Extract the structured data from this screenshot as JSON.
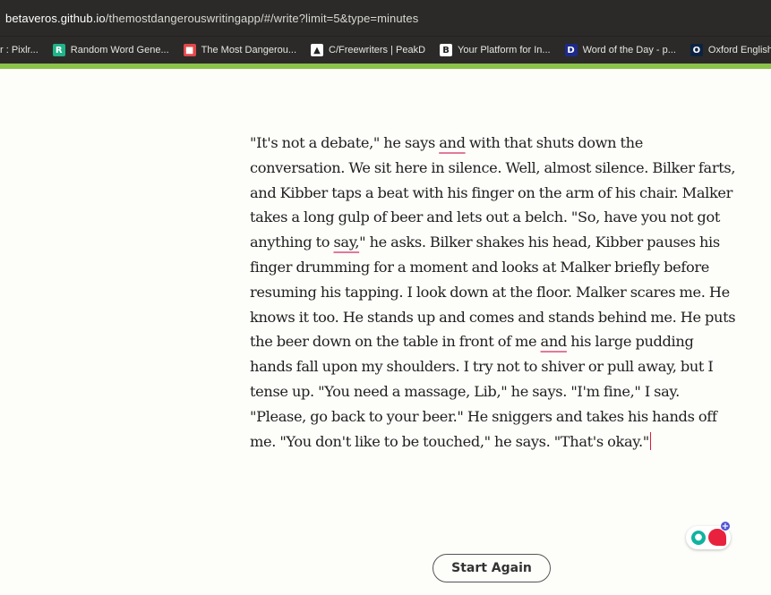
{
  "browser": {
    "url_domain": "betaveros.github.io",
    "url_path": "/themostdangerouswritingapp/#/write?limit=5&type=minutes",
    "bookmarks": [
      {
        "label": "r : Pixlr...",
        "icon": "",
        "icon_color": ""
      },
      {
        "label": "Random Word Gene...",
        "icon": "R",
        "icon_color": "#1fb38a"
      },
      {
        "label": "The Most Dangerou...",
        "icon": "■",
        "icon_color": "#e2474a"
      },
      {
        "label": "C/Freewriters | PeakD",
        "icon": "▲",
        "icon_color": "#ffffff"
      },
      {
        "label": "Your Platform for In...",
        "icon": "B",
        "icon_color": "#ffffff"
      },
      {
        "label": "Word of the Day - p...",
        "icon": "D",
        "icon_color": "#1d2a8c"
      },
      {
        "label": "Oxford English Dic",
        "icon": "O",
        "icon_color": "#0b2341"
      }
    ]
  },
  "accent_color": "#8bc34a",
  "editor": {
    "segments": [
      {
        "text": "\"It's not a debate,\" he says "
      },
      {
        "text": "and",
        "flag": true
      },
      {
        "text": " with that shuts down the conversation. We sit here in silence. Well, almost silence. Bilker farts, and Kibber taps a beat with his finger on the arm of his chair. Malker takes a long gulp of beer and lets out a belch. \"So, have you not got anything to "
      },
      {
        "text": "say,",
        "flag": true
      },
      {
        "text": "\" he asks. Bilker shakes his head, Kibber pauses his finger drumming for a moment and looks at Malker briefly before resuming his tapping. I look down at the floor. Malker scares me. He knows it too. He stands up and comes and stands behind me. He puts the beer down on the table in front of me "
      },
      {
        "text": "and",
        "flag": true
      },
      {
        "text": " his large pudding hands fall upon my shoulders. I try not to shiver or pull away, but I tense up. \"You need a massage, Lib,\" he says. \"I'm fine,\" I say. \"Please, go back to your beer.\" He sniggers and takes his hands off me. \"You don't like to be touched,\" he says. \"That's okay.\""
      }
    ]
  },
  "widget": {
    "bulb_icon": "lightbulb-icon",
    "chat_icon": "chat-bubble-icon",
    "plus_glyph": "+"
  },
  "start_again_label": "Start Again"
}
